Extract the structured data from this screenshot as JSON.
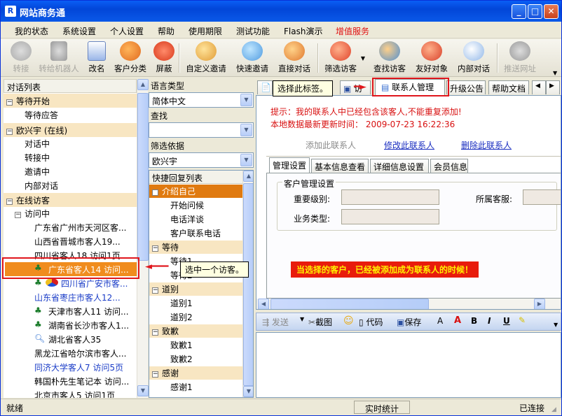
{
  "window": {
    "title": "网站商务通",
    "app_icon": "R"
  },
  "menu": [
    "我的状态",
    "系统设置",
    "个人设置",
    "帮助",
    "使用期限",
    "测试功能",
    "Flash演示",
    "增值服务"
  ],
  "menu_highlight_color": "#e01010",
  "toolbar": [
    {
      "label": "转接",
      "icon": "transfer-icon",
      "disabled": true
    },
    {
      "label": "转给机器人",
      "icon": "robot-icon",
      "disabled": true
    },
    {
      "label": "改名",
      "icon": "rename-icon",
      "disabled": false
    },
    {
      "label": "客户分类",
      "icon": "customer-category-icon",
      "disabled": false
    },
    {
      "label": "屏蔽",
      "icon": "block-icon",
      "disabled": false
    },
    {
      "label": "自定义邀请",
      "icon": "custom-invite-icon",
      "disabled": false
    },
    {
      "label": "快速邀请",
      "icon": "quick-invite-icon",
      "disabled": false
    },
    {
      "label": "直接对话",
      "icon": "direct-chat-icon",
      "disabled": false
    },
    {
      "label": "筛选访客",
      "icon": "filter-visitor-icon",
      "disabled": false
    },
    {
      "label": "查找访客",
      "icon": "find-visitor-icon",
      "disabled": false
    },
    {
      "label": "友好对象",
      "icon": "friend-icon",
      "disabled": false
    },
    {
      "label": "内部对话",
      "icon": "internal-chat-icon",
      "disabled": false
    },
    {
      "label": "推送网址",
      "icon": "push-url-icon",
      "disabled": true
    }
  ],
  "left_panel": {
    "header": "对话列表",
    "groups": [
      {
        "label": "等待开始",
        "items": [
          "等待应答"
        ]
      },
      {
        "label": "欧兴宇 (在线)",
        "items": [
          "对话中",
          "转接中",
          "邀请中",
          "内部对话"
        ]
      },
      {
        "label": "在线访客",
        "sub": "访问中",
        "items": [
          {
            "text": "广东省广州市天河区客...",
            "color": "#000"
          },
          {
            "text": "山西省晋城市客人19...",
            "color": "#000"
          },
          {
            "text": "四川省客人18 访问1页",
            "color": "#000"
          },
          {
            "text": "广东省客人14 访问...",
            "color": "#000",
            "selected": true
          },
          {
            "text": "四川省广安市客...",
            "color": "#1a3cc7"
          },
          {
            "text": "山东省枣庄市客人12...",
            "color": "#1a3cc7"
          },
          {
            "text": "天津市客人11 访问...",
            "color": "#000"
          },
          {
            "text": "湖南省长沙市客人1...",
            "color": "#000"
          },
          {
            "text": "湖北省客人35",
            "color": "#000"
          },
          {
            "text": "黑龙江省哈尔滨市客人...",
            "color": "#000"
          },
          {
            "text": "同济大学客人7 访问5页",
            "color": "#1a3cc7"
          },
          {
            "text": "韩国朴先生笔记本 访问...",
            "color": "#000"
          },
          {
            "text": "北京市客人5 访问1页",
            "color": "#000"
          }
        ]
      }
    ]
  },
  "middle_panel": {
    "lang_label": "语言类型",
    "lang_value": "简体中文",
    "find_label": "查找",
    "find_value": "",
    "filter_label": "筛选依据",
    "filter_value": "欧兴宇",
    "quick_reply_header": "快捷回复列表",
    "groups": [
      {
        "label": "介绍自己",
        "selected": true,
        "items": [
          "开始问候",
          "电话洋谈",
          "客户联系电话"
        ]
      },
      {
        "label": "等待",
        "items": [
          "等待1",
          "等待2"
        ]
      },
      {
        "label": "道别",
        "items": [
          "道别1",
          "道别2"
        ]
      },
      {
        "label": "致歉",
        "items": [
          "致歉1",
          "致歉2"
        ]
      },
      {
        "label": "感谢",
        "items": [
          "感谢1"
        ]
      }
    ]
  },
  "right_panel": {
    "tabs": [
      "选择此标签。",
      "联系人管理",
      "升级公告",
      "帮助文档"
    ],
    "tab_partial": "访",
    "hint_line": "提示：我的联系人中已经包含该客人,不能重复添加!",
    "update_line": "本地数据最新更新时间：  2009-07-23   16:22:36",
    "add_contact": "添加此联系人",
    "edit_contact": "修改此联系人",
    "delete_contact": "删除此联系人",
    "subtabs": [
      "管理设置",
      "基本信息查看",
      "详细信息设置",
      "会员信息"
    ],
    "group_title": "客户管理设置",
    "importance_label": "重要级别:",
    "service_label": "所属客服:",
    "business_label": "业务类型:",
    "banner": "当选择的客户，已经被添加成为联系人的时候！"
  },
  "callouts": {
    "select_visitor": "选中一个访客。"
  },
  "chat_toolbar": {
    "send": "发送",
    "screenshot": "截图",
    "code": "代码",
    "save": "保存",
    "fmt_a": "A",
    "bold": "B",
    "italic": "I",
    "underline": "U"
  },
  "status": {
    "left": "就绪",
    "middle": "实时统计",
    "right": "已连接"
  }
}
